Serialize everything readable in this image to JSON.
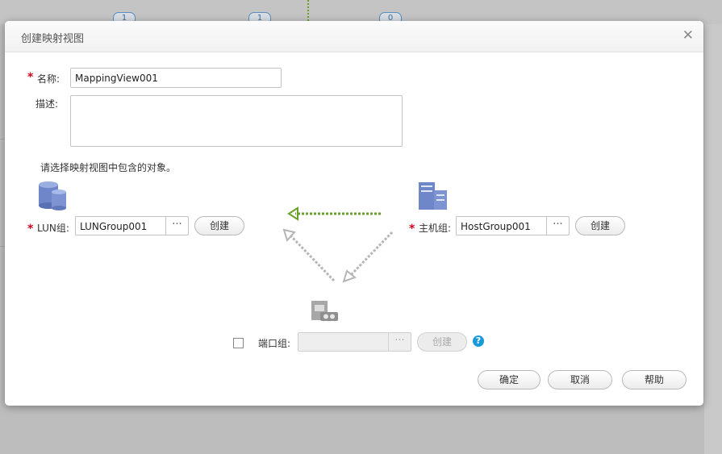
{
  "background": {
    "badges": [
      "1",
      "1",
      "0"
    ]
  },
  "dialog": {
    "title": "创建映射视图",
    "close_glyph": "✕",
    "name_label": "名称:",
    "name_value": "MappingView001",
    "desc_label": "描述:",
    "desc_value": "",
    "instruction": "请选择映射视图中包含的对象。",
    "lun_group": {
      "label": "LUN组:",
      "value": "LUNGroup001",
      "more_glyph": "···",
      "create_label": "创建",
      "icon": "database-icon"
    },
    "host_group": {
      "label": "主机组:",
      "value": "HostGroup001",
      "more_glyph": "···",
      "create_label": "创建",
      "icon": "server-icon"
    },
    "port_group": {
      "label": "端口组:",
      "value": "",
      "more_glyph": "···",
      "create_label": "创建",
      "help_glyph": "?",
      "icon": "port-group-icon",
      "checked": false
    },
    "footer": {
      "ok_label": "确定",
      "cancel_label": "取消",
      "help_label": "帮助"
    }
  },
  "colors": {
    "required": "#d0021b",
    "green_arrow": "#6aa12c",
    "gray_arrow": "#b5b5b5",
    "icon_blue": "#6f86c9",
    "help_blue": "#1a9ad9"
  }
}
